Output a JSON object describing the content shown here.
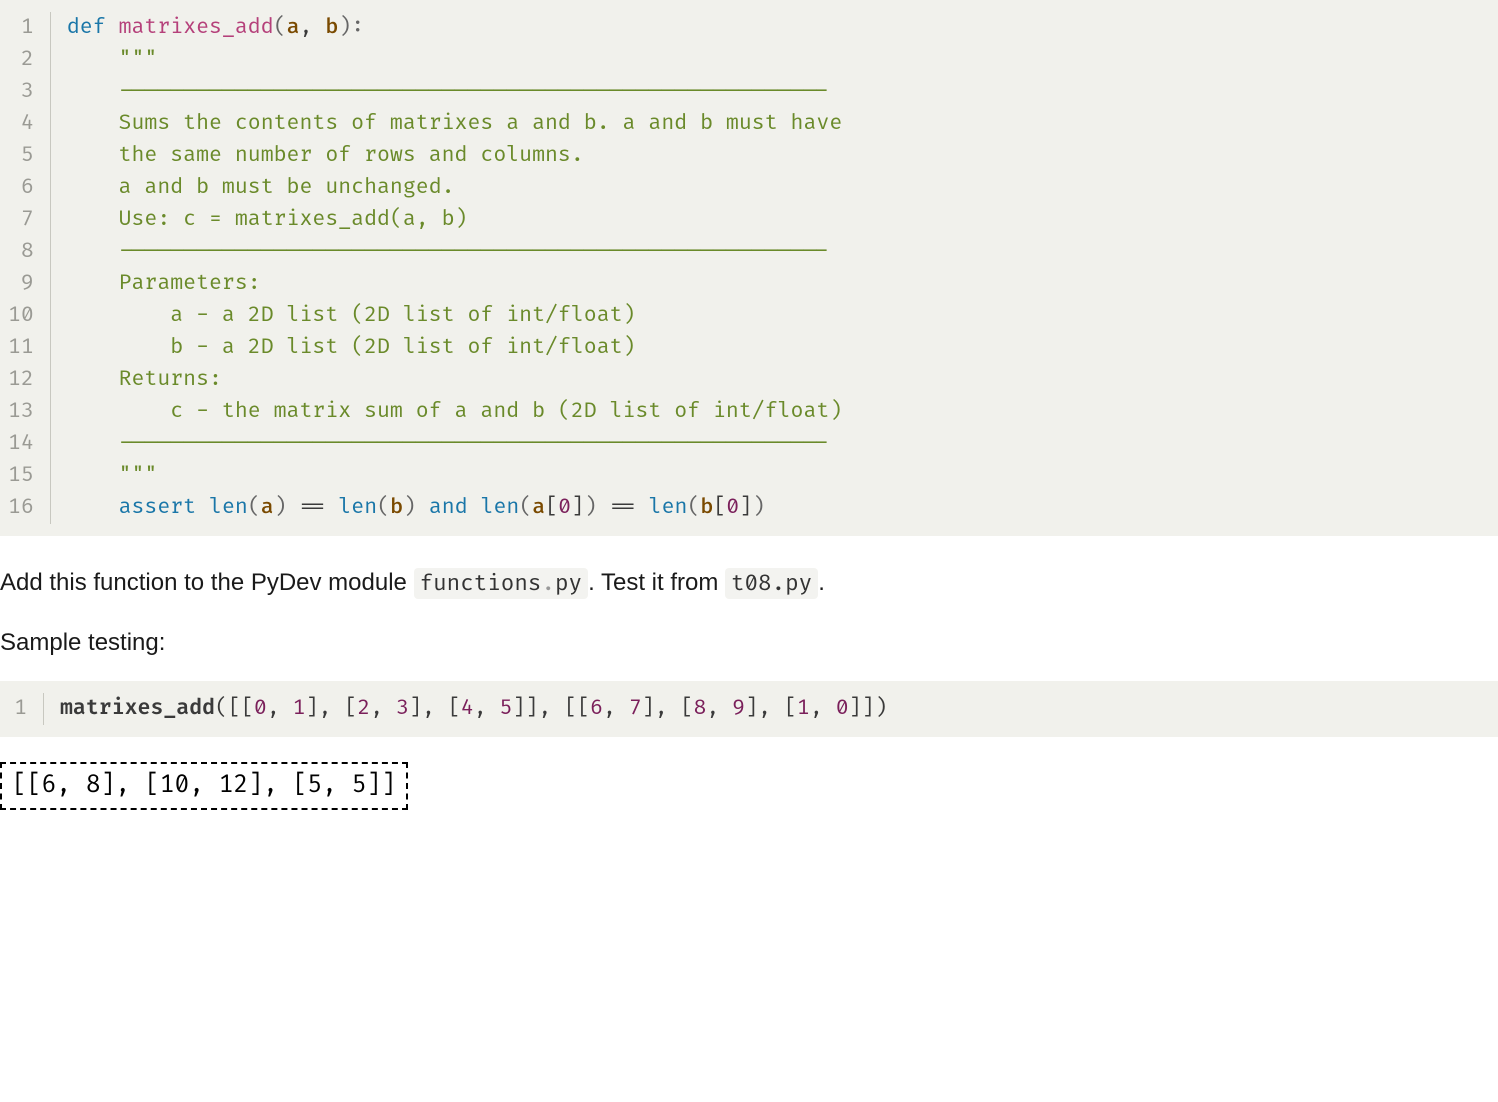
{
  "code1": {
    "lines": [
      "1",
      "2",
      "3",
      "4",
      "5",
      "6",
      "7",
      "8",
      "9",
      "10",
      "11",
      "12",
      "13",
      "14",
      "15",
      "16"
    ],
    "l1_def": "def",
    "l1_fn": "matrixes_add",
    "l1_open": "(",
    "l1_a": "a",
    "l1_comma": ", ",
    "l1_b": "b",
    "l1_close": "):",
    "l2": "    \"\"\"",
    "l3": "    -------------------------------------------------------",
    "l4": "    Sums the contents of matrixes a and b. a and b must have",
    "l5": "    the same number of rows and columns.",
    "l6": "    a and b must be unchanged.",
    "l7": "    Use: c = matrixes_add(a, b)",
    "l8": "    -------------------------------------------------------",
    "l9": "    Parameters:",
    "l10": "        a - a 2D list (2D list of int/float)",
    "l11": "        b - a 2D list (2D list of int/float)",
    "l12": "    Returns:",
    "l13": "        c - the matrix sum of a and b (2D list of int/float)",
    "l14": "    -------------------------------------------------------",
    "l15": "    \"\"\"",
    "l16_assert": "assert",
    "l16_len1": "len",
    "l16_po": "(",
    "l16_a": "a",
    "l16_pc": ")",
    "l16_eq": " == ",
    "l16_len2": "len",
    "l16_b": "b",
    "l16_and": " and ",
    "l16_len3": "len",
    "l16_a2": "a",
    "l16_bo": "[",
    "l16_zero": "0",
    "l16_bc": "]",
    "l16_len4": "len",
    "l16_b2": "b"
  },
  "instruction": {
    "pre": "Add this function to the PyDev module ",
    "mod1a": "functions",
    "mod1dot": ".",
    "mod1b": "py",
    "mid": ". Test it from ",
    "mod2": "t08.py",
    "post": "."
  },
  "sample_label": "Sample testing:",
  "code2": {
    "line_num": "1",
    "fn": "matrixes_add",
    "po": "(",
    "seg1": "[[",
    "n0": "0",
    "c": ", ",
    "n1": "1",
    "seg2": "], [",
    "n2": "2",
    "n3": "3",
    "n4": "4",
    "n5": "5",
    "seg3": "]], [[",
    "n6": "6",
    "n7": "7",
    "n8": "8",
    "n9": "9",
    "n1b": "1",
    "n0b": "0",
    "seg4": "]])"
  },
  "output": "[[6, 8], [10, 12], [5, 5]]"
}
